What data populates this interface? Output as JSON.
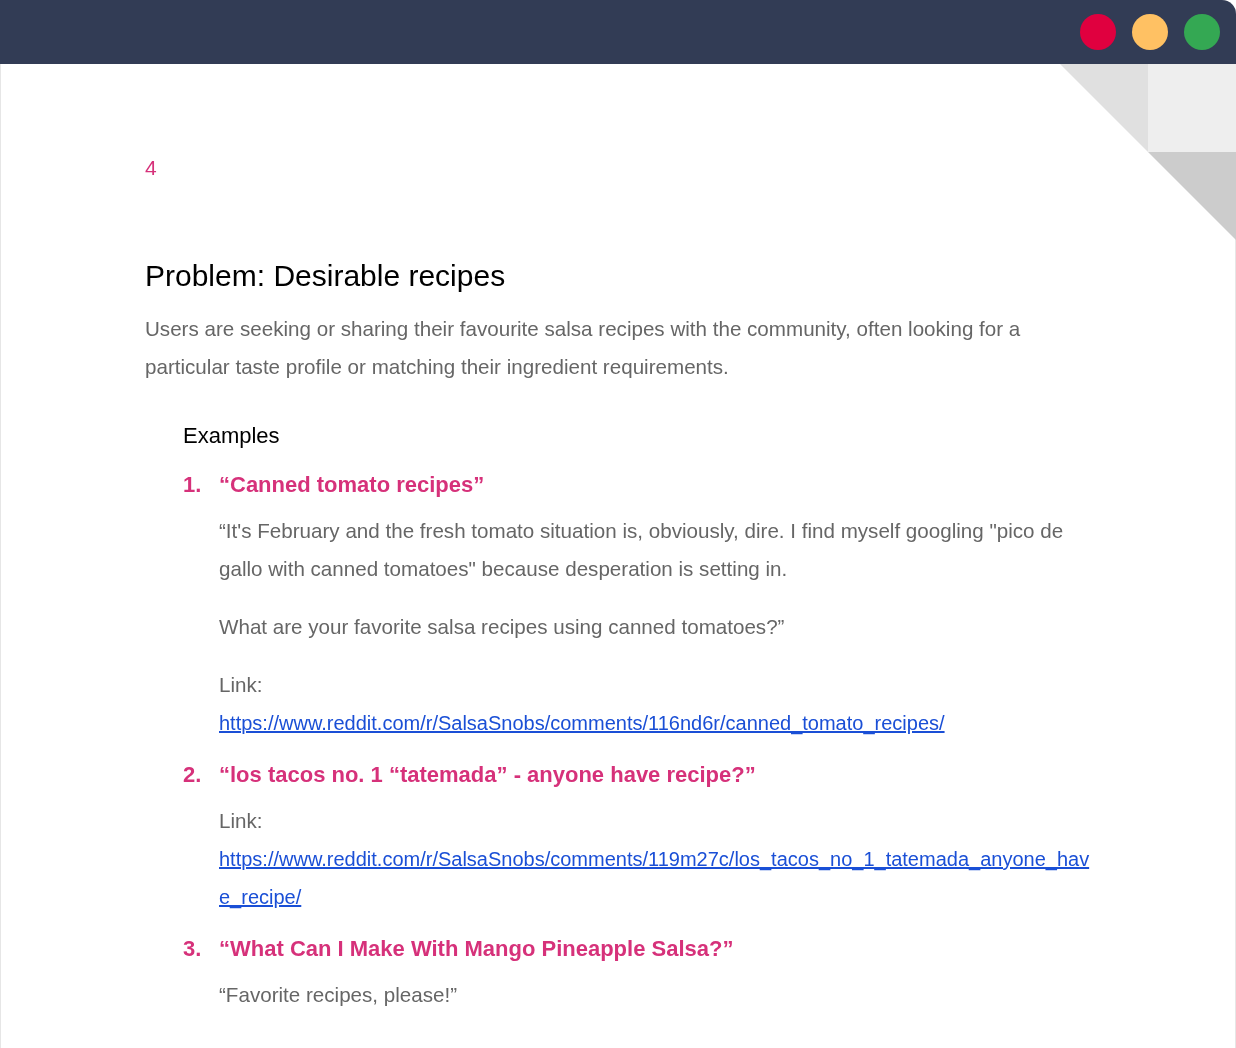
{
  "window_controls": [
    {
      "color": "#e0003f"
    },
    {
      "color": "#ffc163"
    },
    {
      "color": "#34a853"
    }
  ],
  "page_number": "4",
  "title": "Problem: Desirable recipes",
  "intro": "Users are seeking or sharing their favourite salsa recipes with the community, often looking for a particular taste profile or matching their ingredient requirements.",
  "examples_heading": "Examples",
  "examples": [
    {
      "number": "1.",
      "title": "“Canned tomato recipes”",
      "paragraphs": [
        "“It's February and the fresh tomato situation is, obviously, dire. I find myself googling \"pico de gallo with canned tomatoes\" because desperation is setting in.",
        "What are your favorite salsa recipes using canned tomatoes?”"
      ],
      "link_label": "Link:",
      "link": "https://www.reddit.com/r/SalsaSnobs/comments/116nd6r/canned_tomato_recipes/"
    },
    {
      "number": "2.",
      "title": "“los tacos no. 1 “tatemada” - anyone have recipe?”",
      "link_label": "Link:",
      "link": "https://www.reddit.com/r/SalsaSnobs/comments/119m27c/los_tacos_no_1_tatemada_anyone_have_recipe/"
    },
    {
      "number": "3.",
      "title": "“What Can I Make With Mango Pineapple Salsa?”",
      "paragraphs": [
        "“Favorite recipes, please!”"
      ]
    }
  ]
}
